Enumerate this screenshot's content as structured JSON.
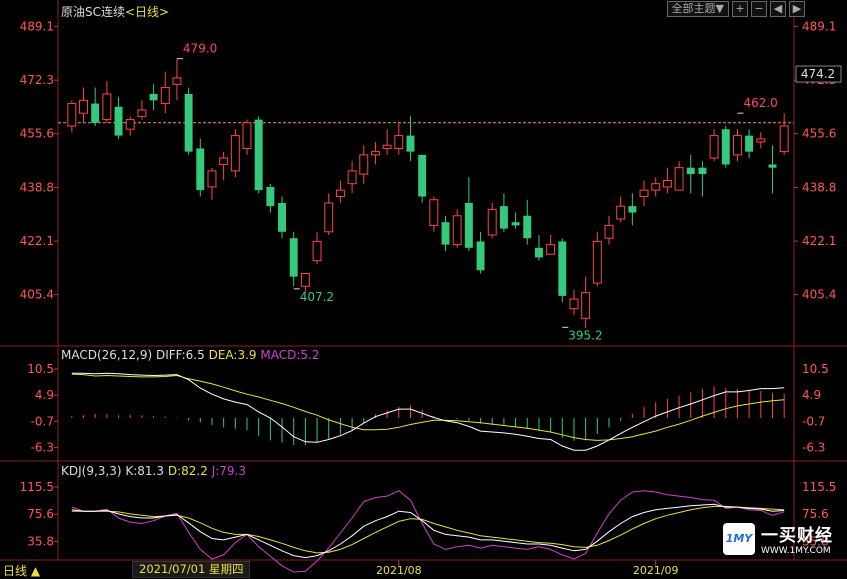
{
  "header": {
    "symbol": "原油SC连续",
    "period": "<日线>",
    "theme_button": "全部主题▼",
    "btn_plus": "+",
    "btn_minus": "−",
    "btn_left": "◀",
    "btn_right": "▶"
  },
  "macd_label": {
    "name": "MACD(26,12,9)",
    "diff": "DIFF:6.5",
    "dea": "DEA:3.9",
    "macd": "MACD:5.2"
  },
  "kdj_label": {
    "name": "KDJ(9,3,3)",
    "k": "K:81.3",
    "d": "D:82.2",
    "j": "J:79.3"
  },
  "footer": {
    "period_tab": "日线 ▲",
    "date_display": "2021/07/01 星期四"
  },
  "watermark": {
    "logo": "1MY",
    "name": "一买财经",
    "url": "WWW.1MY.COM"
  },
  "colors": {
    "up": "#ff4444",
    "down": "#35c97c",
    "diff": "#ffffff",
    "dea": "#e8e03a",
    "macd_label": "#d040d0",
    "j": "#d040d0",
    "price_line": "#e89a3a"
  },
  "chart_data": {
    "type": "candlestick",
    "price_axis": {
      "min": 390,
      "max": 492,
      "ticks": [
        489.1,
        472.3,
        455.6,
        438.8,
        422.1,
        405.4
      ]
    },
    "current_price_label": "474.2",
    "reference_line": 459,
    "x_labels": [
      "2021/08",
      "2021/09"
    ],
    "x_label_index": [
      28,
      50
    ],
    "annotations": [
      {
        "text": "479.0",
        "index": 9,
        "value": 479.0,
        "type": "high"
      },
      {
        "text": "407.2",
        "index": 19,
        "value": 407.2,
        "type": "low"
      },
      {
        "text": "395.2",
        "index": 42,
        "value": 395.2,
        "type": "low"
      },
      {
        "text": "462.0",
        "index": 57,
        "value": 462.0,
        "type": "high"
      }
    ],
    "candles": [
      {
        "o": 458,
        "h": 466,
        "l": 456,
        "c": 465
      },
      {
        "o": 462,
        "h": 470,
        "l": 459,
        "c": 466
      },
      {
        "o": 465,
        "h": 470,
        "l": 458,
        "c": 459
      },
      {
        "o": 460,
        "h": 472,
        "l": 459,
        "c": 468
      },
      {
        "o": 464,
        "h": 467,
        "l": 454,
        "c": 455
      },
      {
        "o": 457,
        "h": 461,
        "l": 455,
        "c": 460
      },
      {
        "o": 461,
        "h": 466,
        "l": 460,
        "c": 463
      },
      {
        "o": 468,
        "h": 471,
        "l": 463,
        "c": 466
      },
      {
        "o": 465,
        "h": 475,
        "l": 462,
        "c": 470
      },
      {
        "o": 471,
        "h": 479,
        "l": 466,
        "c": 473
      },
      {
        "o": 468,
        "h": 470,
        "l": 449,
        "c": 450
      },
      {
        "o": 451,
        "h": 454,
        "l": 436,
        "c": 438
      },
      {
        "o": 439,
        "h": 445,
        "l": 435,
        "c": 444
      },
      {
        "o": 446,
        "h": 450,
        "l": 441,
        "c": 448
      },
      {
        "o": 444,
        "h": 457,
        "l": 442,
        "c": 455
      },
      {
        "o": 451,
        "h": 460,
        "l": 449,
        "c": 459
      },
      {
        "o": 460,
        "h": 461,
        "l": 437,
        "c": 438
      },
      {
        "o": 439,
        "h": 440,
        "l": 431,
        "c": 433
      },
      {
        "o": 434,
        "h": 436,
        "l": 423,
        "c": 425
      },
      {
        "o": 423,
        "h": 425,
        "l": 408,
        "c": 411
      },
      {
        "o": 408,
        "h": 412,
        "l": 406,
        "c": 412
      },
      {
        "o": 416,
        "h": 425,
        "l": 415,
        "c": 422
      },
      {
        "o": 425,
        "h": 437,
        "l": 424,
        "c": 434
      },
      {
        "o": 436,
        "h": 441,
        "l": 434,
        "c": 438
      },
      {
        "o": 440,
        "h": 447,
        "l": 437,
        "c": 444
      },
      {
        "o": 443,
        "h": 452,
        "l": 440,
        "c": 449
      },
      {
        "o": 449,
        "h": 453,
        "l": 446,
        "c": 450
      },
      {
        "o": 451,
        "h": 457,
        "l": 449,
        "c": 452
      },
      {
        "o": 451,
        "h": 459,
        "l": 449,
        "c": 455
      },
      {
        "o": 455,
        "h": 461,
        "l": 447,
        "c": 450
      },
      {
        "o": 449,
        "h": 449,
        "l": 434,
        "c": 436
      },
      {
        "o": 427,
        "h": 436,
        "l": 425,
        "c": 435
      },
      {
        "o": 428,
        "h": 430,
        "l": 419,
        "c": 421
      },
      {
        "o": 421,
        "h": 432,
        "l": 420,
        "c": 430
      },
      {
        "o": 434,
        "h": 442,
        "l": 419,
        "c": 420
      },
      {
        "o": 422,
        "h": 425,
        "l": 412,
        "c": 413
      },
      {
        "o": 424,
        "h": 434,
        "l": 423,
        "c": 432
      },
      {
        "o": 433,
        "h": 437,
        "l": 425,
        "c": 426
      },
      {
        "o": 428,
        "h": 431,
        "l": 426,
        "c": 427
      },
      {
        "o": 430,
        "h": 435,
        "l": 421,
        "c": 423
      },
      {
        "o": 420,
        "h": 424,
        "l": 416,
        "c": 417
      },
      {
        "o": 418,
        "h": 424,
        "l": 418,
        "c": 421
      },
      {
        "o": 422,
        "h": 423,
        "l": 403,
        "c": 405
      },
      {
        "o": 401,
        "h": 407,
        "l": 399,
        "c": 404
      },
      {
        "o": 398,
        "h": 411,
        "l": 395,
        "c": 406
      },
      {
        "o": 409,
        "h": 425,
        "l": 408,
        "c": 422
      },
      {
        "o": 423,
        "h": 430,
        "l": 421,
        "c": 427
      },
      {
        "o": 429,
        "h": 436,
        "l": 428,
        "c": 433
      },
      {
        "o": 433,
        "h": 437,
        "l": 427,
        "c": 431
      },
      {
        "o": 436,
        "h": 441,
        "l": 433,
        "c": 438
      },
      {
        "o": 438,
        "h": 442,
        "l": 436,
        "c": 440
      },
      {
        "o": 439,
        "h": 445,
        "l": 437,
        "c": 441
      },
      {
        "o": 438,
        "h": 447,
        "l": 438,
        "c": 445
      },
      {
        "o": 445,
        "h": 449,
        "l": 437,
        "c": 443
      },
      {
        "o": 445,
        "h": 447,
        "l": 436,
        "c": 443
      },
      {
        "o": 448,
        "h": 457,
        "l": 447,
        "c": 455
      },
      {
        "o": 457,
        "h": 458,
        "l": 445,
        "c": 446
      },
      {
        "o": 449,
        "h": 457,
        "l": 447,
        "c": 455
      },
      {
        "o": 455,
        "h": 457,
        "l": 448,
        "c": 450
      },
      {
        "o": 453,
        "h": 456,
        "l": 451,
        "c": 454
      },
      {
        "o": 446,
        "h": 452,
        "l": 437,
        "c": 445
      },
      {
        "o": 450,
        "h": 462,
        "l": 449,
        "c": 458
      }
    ],
    "macd": {
      "axis": {
        "min": -9,
        "max": 12,
        "ticks": [
          10.5,
          4.9,
          -0.7,
          -6.3
        ]
      },
      "histogram": [
        0.4,
        0.6,
        0.9,
        0.8,
        0.6,
        0.7,
        0.6,
        0.4,
        0.3,
        0.1,
        -0.5,
        -1.0,
        -1.5,
        -2.0,
        -2.3,
        -2.6,
        -3.8,
        -4.8,
        -5.3,
        -5.8,
        -5.8,
        -5.3,
        -4.6,
        -3.6,
        -2.6,
        -1.1,
        0.8,
        1.6,
        2.4,
        2.7,
        1.8,
        0.5,
        0.1,
        -0.2,
        -0.6,
        -1.2,
        -1.5,
        -1.7,
        -1.9,
        -2.3,
        -2.7,
        -3.1,
        -4.2,
        -4.9,
        -4.8,
        -3.4,
        -2.0,
        -0.6,
        0.9,
        2.4,
        3.4,
        4.1,
        4.8,
        5.5,
        6.3,
        6.8,
        6.4,
        6.2,
        5.9,
        5.8,
        5.4,
        5.2
      ],
      "diff": [
        9.6,
        9.6,
        9.5,
        9.6,
        9.5,
        9.3,
        9.2,
        9.1,
        9.2,
        9.3,
        8.2,
        6.4,
        5.1,
        4.1,
        3.4,
        2.9,
        1.3,
        0.0,
        -1.9,
        -4.0,
        -5.1,
        -5.2,
        -4.6,
        -3.8,
        -2.7,
        -1.1,
        0.3,
        1.1,
        1.9,
        1.9,
        1.0,
        0.1,
        -0.6,
        -1.0,
        -1.8,
        -2.8,
        -3.0,
        -3.2,
        -3.5,
        -3.9,
        -4.4,
        -4.6,
        -6.0,
        -6.9,
        -6.9,
        -6.0,
        -4.7,
        -3.3,
        -2.0,
        -0.8,
        0.4,
        1.3,
        2.2,
        3.0,
        3.9,
        4.8,
        5.6,
        5.6,
        5.9,
        6.3,
        6.3,
        6.5
      ],
      "dea": [
        9.4,
        9.3,
        9.0,
        9.1,
        9.0,
        8.9,
        8.8,
        8.8,
        8.9,
        9.1,
        8.4,
        7.9,
        7.3,
        6.6,
        5.8,
        5.1,
        4.5,
        3.8,
        3.1,
        2.3,
        1.4,
        0.6,
        -0.4,
        -1.2,
        -2.0,
        -2.5,
        -2.5,
        -2.4,
        -2.0,
        -1.4,
        -0.9,
        -0.5,
        -0.5,
        -0.6,
        -0.8,
        -1.0,
        -1.3,
        -1.6,
        -1.9,
        -2.2,
        -2.6,
        -3.0,
        -3.6,
        -4.2,
        -4.6,
        -4.8,
        -4.7,
        -4.4,
        -4.0,
        -3.4,
        -2.8,
        -2.0,
        -1.3,
        -0.5,
        0.4,
        1.2,
        2.0,
        2.6,
        3.0,
        3.4,
        3.7,
        3.9
      ]
    },
    "kdj": {
      "axis": {
        "min": 10,
        "max": 130,
        "ticks": [
          115.5,
          75.6,
          35.8
        ]
      },
      "k": [
        82,
        80,
        80,
        81,
        76,
        72,
        70,
        70,
        73,
        75,
        63,
        50,
        40,
        38,
        42,
        46,
        38,
        30,
        22,
        15,
        12,
        15,
        22,
        32,
        44,
        58,
        66,
        72,
        80,
        78,
        66,
        52,
        46,
        44,
        42,
        38,
        38,
        36,
        34,
        32,
        32,
        30,
        26,
        22,
        24,
        36,
        50,
        62,
        72,
        78,
        82,
        84,
        86,
        88,
        89,
        90,
        86,
        86,
        84,
        83,
        80,
        81
      ],
      "d": [
        80,
        80,
        80,
        80,
        79,
        76,
        74,
        72,
        73,
        74,
        70,
        63,
        55,
        49,
        46,
        46,
        43,
        38,
        33,
        27,
        22,
        19,
        20,
        24,
        31,
        40,
        49,
        57,
        65,
        69,
        68,
        62,
        57,
        52,
        48,
        44,
        42,
        40,
        38,
        36,
        34,
        33,
        31,
        28,
        27,
        30,
        37,
        45,
        54,
        62,
        69,
        74,
        78,
        82,
        85,
        87,
        87,
        86,
        85,
        84,
        83,
        82
      ],
      "j": [
        86,
        80,
        80,
        83,
        70,
        64,
        62,
        66,
        73,
        77,
        49,
        24,
        10,
        16,
        34,
        46,
        28,
        14,
        0,
        -9,
        -8,
        7,
        26,
        48,
        70,
        94,
        100,
        102,
        110,
        96,
        62,
        32,
        24,
        28,
        30,
        26,
        30,
        28,
        26,
        24,
        28,
        24,
        16,
        10,
        18,
        48,
        76,
        96,
        108,
        110,
        108,
        104,
        102,
        100,
        97,
        96,
        84,
        86,
        82,
        81,
        74,
        79
      ]
    }
  }
}
